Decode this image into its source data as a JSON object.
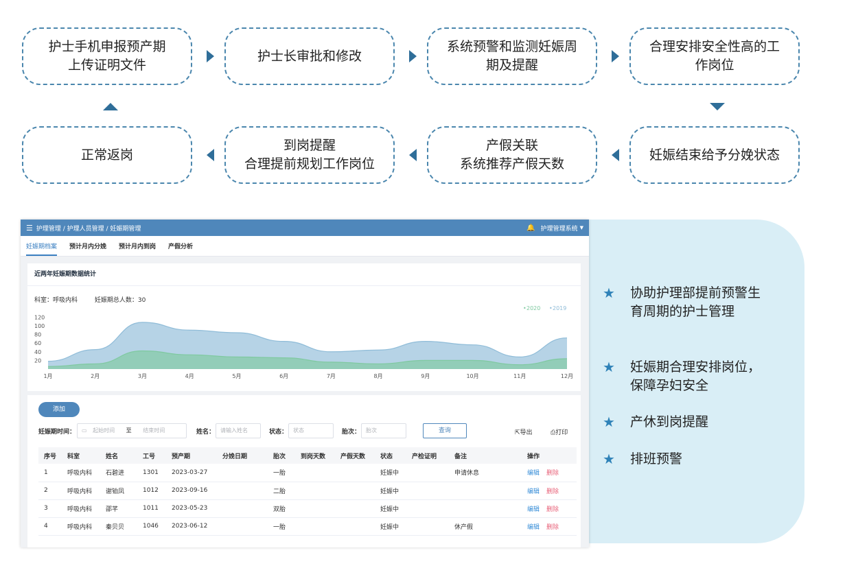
{
  "flow": {
    "step1": [
      "护士手机申报预产期",
      "上传证明文件"
    ],
    "step2": [
      "护士长审批和修改"
    ],
    "step3": [
      "系统预警和监测妊娠周",
      "期及提醒"
    ],
    "step4": [
      "合理安排安全性高的工",
      "作岗位"
    ],
    "step5": [
      "妊娠结束给予分娩状态"
    ],
    "step6": [
      "产假关联",
      "系统推荐产假天数"
    ],
    "step7": [
      "到岗提醒",
      "合理提前规划工作岗位"
    ],
    "step8": [
      "正常返岗"
    ]
  },
  "features": [
    [
      "协助护理部提前预警生",
      "育周期的护士管理"
    ],
    [
      "妊娠期合理安排岗位，",
      "保障孕妇安全"
    ],
    [
      "产休到岗提醒"
    ],
    [
      "排班预警"
    ]
  ],
  "app": {
    "breadcrumb": "护理管理 / 护理人员管理 / 妊娠期管理",
    "system_name": "护理管理系统",
    "tabs": [
      "妊娠期档案",
      "预计月内分娩",
      "预计月内到岗",
      "产假分析"
    ],
    "chart_card_title": "近两年妊娠期数据统计",
    "dept_label": "科室：呼吸内科",
    "total_label": "妊娠期总人数：30",
    "add_button": "添加",
    "filters": {
      "period_label": "妊娠期时间：",
      "start_placeholder": "起始时间",
      "to": "至",
      "end_placeholder": "结束时间",
      "name_label": "姓名：",
      "name_placeholder": "请输入姓名",
      "status_label": "状态：",
      "status_placeholder": "状态",
      "parity_label": "胎次：",
      "parity_placeholder": "胎次",
      "query_button": "查询",
      "export": "导出",
      "print": "打印"
    },
    "table": {
      "headers": [
        "序号",
        "科室",
        "姓名",
        "工号",
        "预产期",
        "分娩日期",
        "胎次",
        "到岗天数",
        "产假天数",
        "状态",
        "产检证明",
        "备注",
        "操作"
      ],
      "rows": [
        [
          "1",
          "呼吸内科",
          "石碧进",
          "1301",
          "2023-03-27",
          "",
          "一胎",
          "",
          "",
          "妊娠中",
          "",
          "申请休息"
        ],
        [
          "2",
          "呼吸内科",
          "谢铂凤",
          "1012",
          "2023-09-16",
          "",
          "二胎",
          "",
          "",
          "妊娠中",
          "",
          ""
        ],
        [
          "3",
          "呼吸内科",
          "邵芊",
          "1011",
          "2023-05-23",
          "",
          "双胎",
          "",
          "",
          "妊娠中",
          "",
          ""
        ],
        [
          "4",
          "呼吸内科",
          "秦贝贝",
          "1046",
          "2023-06-12",
          "",
          "一胎",
          "",
          "",
          "妊娠中",
          "",
          "休产假"
        ]
      ],
      "edit": "编辑",
      "delete": "删除"
    }
  },
  "chart_data": {
    "type": "area",
    "categories": [
      "1月",
      "2月",
      "3月",
      "4月",
      "5月",
      "6月",
      "7月",
      "8月",
      "9月",
      "10月",
      "11月",
      "12月"
    ],
    "yticks": [
      20,
      40,
      60,
      80,
      100,
      120
    ],
    "ylim": [
      0,
      130
    ],
    "series": [
      {
        "name": "2019",
        "color": "#8fbcd8",
        "values": [
          18,
          45,
          108,
          90,
          84,
          64,
          40,
          44,
          64,
          56,
          28,
          72
        ]
      },
      {
        "name": "2020",
        "color": "#7fc9a0",
        "values": [
          6,
          12,
          42,
          33,
          28,
          26,
          16,
          12,
          20,
          20,
          10,
          24
        ]
      }
    ],
    "legend": "top-right"
  }
}
